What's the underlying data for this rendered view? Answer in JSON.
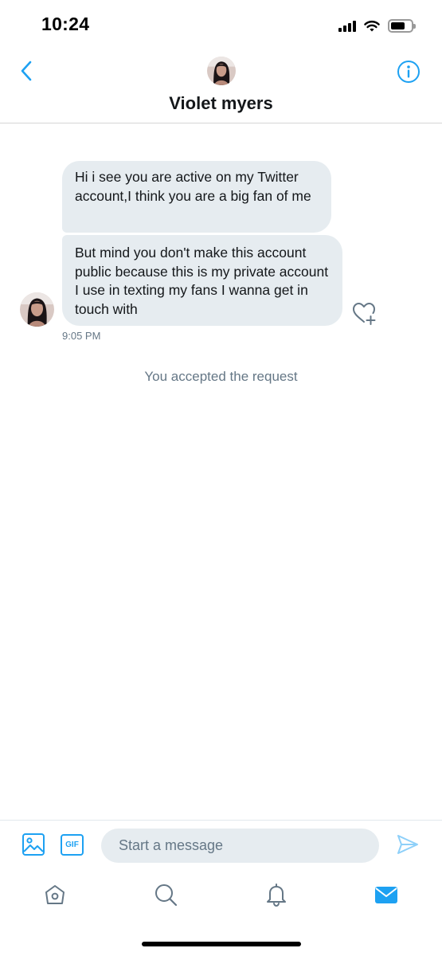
{
  "status_bar": {
    "time": "10:24",
    "icons": [
      "cellular-signal-icon",
      "wifi-icon",
      "battery-icon"
    ]
  },
  "header": {
    "contact_name": "Violet myers",
    "back_icon": "chevron-left-icon",
    "info_icon": "info-circle-icon"
  },
  "conversation": {
    "messages": [
      {
        "text": "Hi i see you are active on my Twitter account,I think you are a big fan of me"
      },
      {
        "text": "But mind you don't make this account public because this is my private account I use in texting my fans I wanna get in touch with"
      }
    ],
    "timestamp": "9:05 PM",
    "system_note": "You accepted the request",
    "reaction_icon": "heart-plus-icon"
  },
  "composer": {
    "placeholder": "Start a message",
    "gif_label": "GIF",
    "media_icon": "image-icon",
    "send_icon": "send-icon"
  },
  "tab_bar": {
    "tabs": [
      "home-icon",
      "search-icon",
      "notifications-bell-icon",
      "messages-envelope-icon"
    ],
    "active": "messages-envelope-icon"
  },
  "colors": {
    "accent": "#1da1f2",
    "bubble": "#e6ecf0",
    "secondary_text": "#657786",
    "primary_text": "#14171a"
  }
}
